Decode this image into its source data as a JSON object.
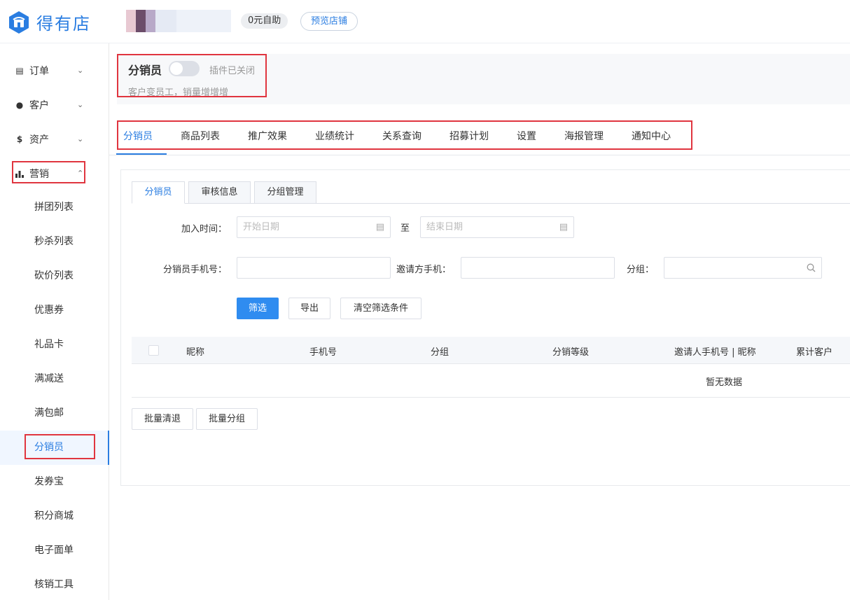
{
  "header": {
    "logo_text": "得有店",
    "plan_badge": "0元自助",
    "preview_button": "预览店铺"
  },
  "sidebar": {
    "groups": [
      {
        "icon": "list-icon",
        "label": "订单"
      },
      {
        "icon": "customers-icon",
        "label": "客户"
      },
      {
        "icon": "dollar-icon",
        "label": "资产"
      },
      {
        "icon": "bar-chart-icon",
        "label": "营销"
      }
    ],
    "sub_items": [
      "拼团列表",
      "秒杀列表",
      "砍价列表",
      "优惠券",
      "礼品卡",
      "满减送",
      "满包邮",
      "分销员",
      "发券宝",
      "积分商城",
      "电子面单",
      "核销工具"
    ],
    "active_sub": "分销员"
  },
  "plugin": {
    "title": "分销员",
    "enabled": false,
    "status_text": "插件已关闭",
    "description": "客户变员工，销量增增增"
  },
  "tabs": [
    "分销员",
    "商品列表",
    "推广效果",
    "业绩统计",
    "关系查询",
    "招募计划",
    "设置",
    "海报管理",
    "通知中心"
  ],
  "active_tab": "分销员",
  "subtabs": [
    "分销员",
    "审核信息",
    "分组管理"
  ],
  "active_subtab": "分销员",
  "filters": {
    "join_time_label": "加入时间：",
    "start_date_placeholder": "开始日期",
    "to_label": "至",
    "end_date_placeholder": "结束日期",
    "phone_label": "分销员手机号：",
    "inviter_phone_label": "邀请方手机：",
    "group_label": "分组："
  },
  "buttons": {
    "filter": "筛选",
    "export": "导出",
    "clear": "清空筛选条件",
    "batch_remove": "批量清退",
    "batch_group": "批量分组"
  },
  "table": {
    "columns": [
      "昵称",
      "手机号",
      "分组",
      "分销等级",
      "邀请人手机号 | 昵称",
      "累计客户"
    ],
    "rows": [],
    "empty_text": "暂无数据"
  },
  "colors": {
    "accent": "#2a7de1",
    "primary_button": "#2f8cf0",
    "highlight_box": "#e0353f"
  }
}
